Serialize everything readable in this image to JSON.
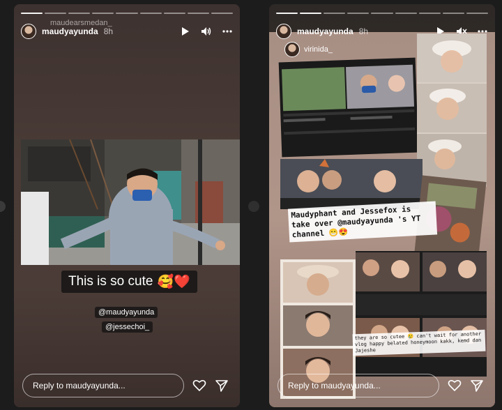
{
  "left_story": {
    "mention_overlay": "maudearsmedan_",
    "username": "maudyayunda",
    "time": "8h",
    "caption_text": "This is so cute",
    "caption_emojis": "🥰❤️",
    "tags": [
      "@maudyayunda",
      "@jessechoi_"
    ],
    "reply_placeholder": "Reply to maudyayunda...",
    "progress": [
      1,
      0,
      0,
      0,
      0,
      0,
      0,
      0,
      0
    ]
  },
  "right_story": {
    "username": "maudyayunda",
    "time": "8h",
    "reshared_from": "virinida_",
    "headline": "Maudyphant and Jessefox is take over @maudyayunda 's YT channel 😁😍",
    "note": "they are so cutee 😢 can't wait for another vlog happy belated honeymoon kakk, kemd dan Jajeshe",
    "reply_placeholder": "Reply to maudyayunda...",
    "progress": [
      1,
      1,
      0,
      0,
      0,
      0,
      0,
      0,
      0
    ]
  },
  "colors": {
    "page_bg": "#1c1c1c",
    "left_bg": "#4a3b36",
    "collage_bg": "#b09589"
  },
  "icons": {
    "play": "play-icon",
    "volume": "volume-icon",
    "muted": "muted-icon",
    "more": "more-icon",
    "heart": "heart-icon",
    "send": "send-icon"
  }
}
